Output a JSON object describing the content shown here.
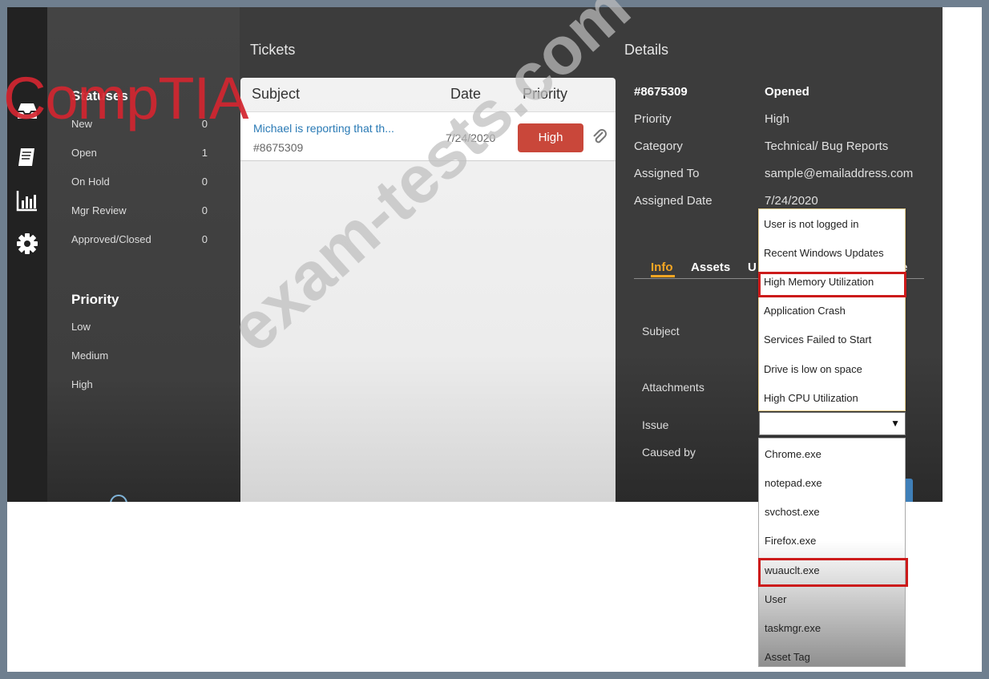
{
  "sidebar": {
    "statuses_title": "Statuses",
    "statuses": [
      {
        "label": "New",
        "count": "0"
      },
      {
        "label": "Open",
        "count": "1"
      },
      {
        "label": "On Hold",
        "count": "0"
      },
      {
        "label": "Mgr Review",
        "count": "0"
      },
      {
        "label": "Approved/Closed",
        "count": "0"
      }
    ],
    "priority_title": "Priority",
    "priorities": [
      "Low",
      "Medium",
      "High"
    ],
    "icons": [
      "inbox-icon",
      "book-icon",
      "bar-chart-icon",
      "gear-icon"
    ]
  },
  "tickets": {
    "title": "Tickets",
    "headers": {
      "subject": "Subject",
      "date": "Date",
      "priority": "Priority"
    },
    "rows": [
      {
        "subject": "Michael is reporting that th...",
        "id": "#8675309",
        "date": "7/24/2020",
        "priority": "High"
      }
    ]
  },
  "details": {
    "title": "Details",
    "ticket_id": "#8675309",
    "status": "Opened",
    "fields": [
      {
        "label": "Priority",
        "value": "High"
      },
      {
        "label": "Category",
        "value": "Technical/ Bug Reports"
      },
      {
        "label": "Assigned To",
        "value": "sample@emailaddress.com"
      },
      {
        "label": "Assigned Date",
        "value": "7/24/2020"
      }
    ],
    "tabs": {
      "info": "Info",
      "assets": "Assets",
      "u": "U",
      "e": "e"
    },
    "form": {
      "subject": "Subject",
      "attachments": "Attachments",
      "issue": "Issue",
      "caused_by": "Caused by"
    },
    "issue_selected": "",
    "issue_options": [
      "User is not logged in",
      "Recent Windows Updates",
      "High Memory Utilization",
      "Application Crash",
      "Services Failed to Start",
      "Drive is low on space",
      "High CPU Utilization"
    ],
    "caused_by_options": [
      "Chrome.exe",
      "notepad.exe",
      "svchost.exe",
      "Firefox.exe",
      "wuauclt.exe",
      "User",
      "taskmgr.exe",
      "Asset Tag"
    ]
  },
  "overlays": {
    "logo_text": "CompTIA",
    "watermark_text": "exam-tests.com"
  },
  "colors": {
    "accent": "#f5a623",
    "priority_high": "#c9473a",
    "highlight": "#cc1a1a",
    "link": "#2a7ab5"
  }
}
